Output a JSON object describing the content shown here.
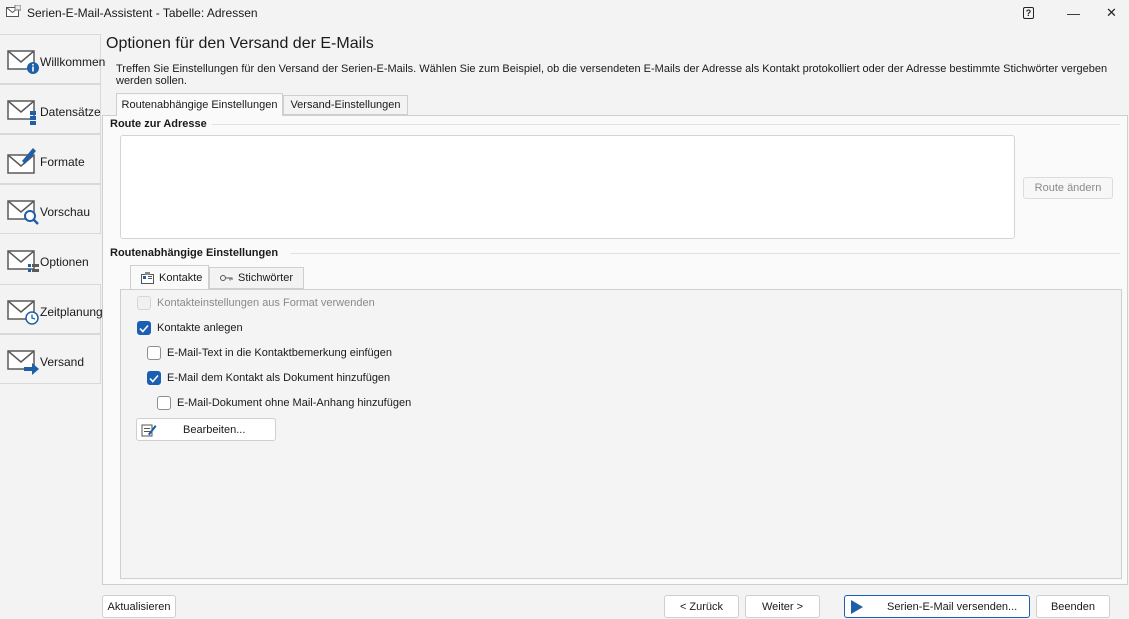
{
  "window": {
    "title": "Serien-E-Mail-Assistent - Tabelle: Adressen",
    "help_label": "?",
    "minimize_label": "—",
    "close_label": "✕"
  },
  "sidebar": {
    "items": [
      {
        "label": "Willkommen",
        "icon": "mail-info-icon"
      },
      {
        "label": "Datensätze",
        "icon": "mail-records-icon"
      },
      {
        "label": "Formate",
        "icon": "mail-pen-icon"
      },
      {
        "label": "Vorschau",
        "icon": "mail-search-icon"
      },
      {
        "label": "Optionen",
        "icon": "mail-options-icon"
      },
      {
        "label": "Zeitplanung",
        "icon": "mail-clock-icon"
      },
      {
        "label": "Versand",
        "icon": "mail-send-icon"
      }
    ],
    "active_index": 4
  },
  "main": {
    "title": "Optionen für den Versand der E-Mails",
    "description": "Treffen Sie Einstellungen für den Versand der Serien-E-Mails. Wählen Sie zum Beispiel, ob die versendeten E-Mails der Adresse als Kontakt protokolliert oder der Adresse bestimmte Stichwörter vergeben werden sollen.",
    "tabs": [
      {
        "label": "Routenabhängige Einstellungen",
        "selected": true
      },
      {
        "label": "Versand-Einstellungen",
        "selected": false
      }
    ]
  },
  "route": {
    "header": "Route zur Adresse",
    "content": "",
    "change_button": "Route ändern"
  },
  "settings": {
    "header": "Routenabhängige Einstellungen",
    "subtabs": [
      {
        "label": "Kontakte",
        "selected": true,
        "icon": "contacts-icon"
      },
      {
        "label": "Stichwörter",
        "selected": false,
        "icon": "key-icon"
      }
    ],
    "options": [
      {
        "label": "Kontakteinstellungen aus Format verwenden",
        "checked": false,
        "disabled": true
      },
      {
        "label": "Kontakte anlegen",
        "checked": true,
        "disabled": false
      },
      {
        "label": "E-Mail-Text in die Kontaktbemerkung einfügen",
        "checked": false,
        "disabled": false
      },
      {
        "label": "E-Mail dem Kontakt als Dokument hinzufügen",
        "checked": true,
        "disabled": false
      },
      {
        "label": "E-Mail-Dokument ohne Mail-Anhang hinzufügen",
        "checked": false,
        "disabled": false
      }
    ],
    "edit_button": "Bearbeiten..."
  },
  "footer": {
    "refresh": "Aktualisieren",
    "back": "< Zurück",
    "next": "Weiter >",
    "send": "Serien-E-Mail versenden...",
    "close": "Beenden"
  },
  "colors": {
    "accent": "#1a5fb4",
    "background": "#f3f3f3"
  }
}
